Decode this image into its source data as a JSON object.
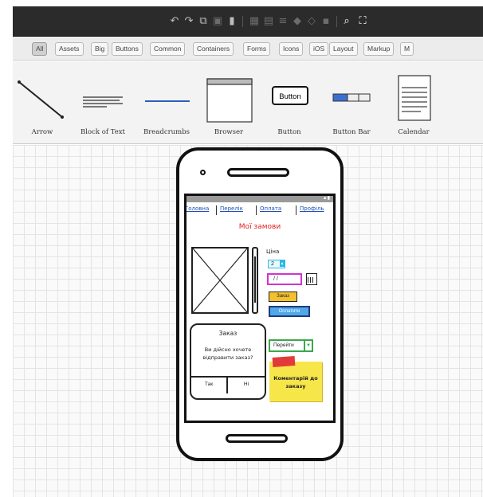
{
  "tabs": [
    "All",
    "Assets",
    "Big",
    "Buttons",
    "Common",
    "Containers",
    "Forms",
    "Icons",
    "iOS",
    "Layout",
    "Markup",
    "M"
  ],
  "gallery": [
    {
      "label": "Arrow",
      "icon": "arrow-line-icon"
    },
    {
      "label": "Block of Text",
      "icon": "text-block-icon"
    },
    {
      "label": "Breadcrumbs",
      "icon": "breadcrumbs-icon"
    },
    {
      "label": "Browser",
      "icon": "browser-window-icon"
    },
    {
      "label": "Button",
      "icon": "button-icon",
      "preview_text": "Button"
    },
    {
      "label": "Button Bar",
      "icon": "button-bar-icon"
    },
    {
      "label": "Calendar",
      "icon": "calendar-icon"
    }
  ],
  "toolbar": {
    "icons": [
      "undo-icon",
      "redo-icon",
      "copy-icon",
      "paste-icon",
      "delete-icon",
      "group-icon",
      "ungroup-icon",
      "align-icon",
      "front-icon",
      "back-icon",
      "lock-icon",
      "search-icon",
      "fullscreen-icon"
    ]
  },
  "mockup": {
    "breadcrumbs": [
      "Головна",
      "Перелік",
      "Оплата",
      "Профіль"
    ],
    "title": "Мої замови",
    "price_label": "Ціна",
    "stepper_value": "2",
    "date_value": "/ /",
    "order_button": "Заказ",
    "pay_button": "Оплатити",
    "dialog": {
      "title": "Заказ",
      "message": "Ви дійсно хочете відправити заказ?",
      "yes": "Так",
      "no": "Ні"
    },
    "combo_value": "Перейти",
    "sticky_note": "Коментарій до заказу"
  },
  "colors": {
    "toolbar_bg": "#2b2b2b",
    "title_red": "#e02020",
    "link_blue": "#1d4fb5",
    "stepper_cyan": "#2bb8e8",
    "date_magenta": "#d232d2",
    "order_yellow": "#f3c12e",
    "pay_blue": "#4fa8ea",
    "combo_green": "#3aa84a",
    "sticky_yellow": "#f7e64a"
  }
}
